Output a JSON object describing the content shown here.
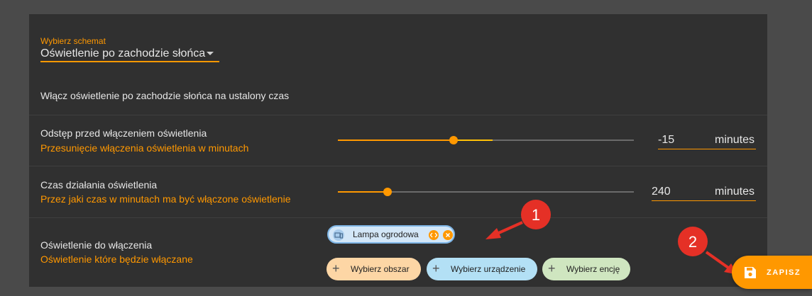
{
  "blueprint_select": {
    "label": "Wybierz schemat",
    "value": "Oświetlenie po zachodzie słońca"
  },
  "description": "Włącz oświetlenie po zachodzie słońca na ustalony czas",
  "offset": {
    "title": "Odstęp przed włączeniem oświetlenia",
    "subtitle": "Przesunięcie włączenia oświetlenia w minutach",
    "value": "-15",
    "suffix": "minutes"
  },
  "duration": {
    "title": "Czas działania oświetlenia",
    "subtitle": "Przez jaki czas w minutach ma być włączone oświetlenie",
    "value": "240",
    "suffix": "minutes"
  },
  "target": {
    "title": "Oświetlenie do włączenia",
    "subtitle": "Oświetlenie które będzie włączane",
    "entity_chip": "Lampa ogrodowa",
    "add_area": "Wybierz obszar",
    "add_device": "Wybierz urządzenie",
    "add_entity": "Wybierz encję"
  },
  "save_button": "ZAPISZ",
  "annotations": {
    "one": "1",
    "two": "2"
  },
  "colors": {
    "accent": "#ff9800",
    "callout": "#e53026",
    "area_chip": "#fdd6a5",
    "device_chip": "#b3e0f5",
    "entity_chip_bg": "#cfe6c0"
  },
  "icons": {
    "caret": "arrow-drop-down-icon",
    "device": "devices-icon",
    "yaml": "code-icon",
    "remove": "close-circle-icon",
    "add": "plus-icon",
    "save": "floppy-disk-icon"
  }
}
